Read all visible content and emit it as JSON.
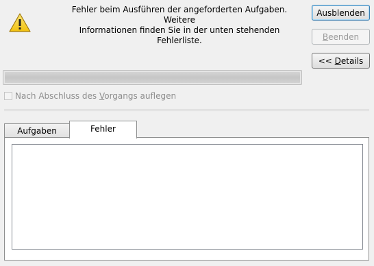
{
  "message": {
    "line1": "Fehler beim Ausführen der angeforderten Aufgaben. Weitere",
    "line2": "Informationen finden Sie in der unten stehenden Fehlerliste."
  },
  "buttons": {
    "hide": "Ausblenden",
    "finish_underlined": "B",
    "finish_rest": "eenden",
    "details_prefix": "<< ",
    "details_underlined": "D",
    "details_rest": "etails"
  },
  "progress": {
    "value": 0
  },
  "checkbox": {
    "label_pre": "Nach Abschluss des ",
    "label_underlined": "V",
    "label_post": "organgs auflegen",
    "checked": false,
    "enabled": false
  },
  "tabs": [
    {
      "label": "Aufgaben",
      "active": false
    },
    {
      "label": "Fehler",
      "active": true
    }
  ],
  "error_list": {
    "items": []
  },
  "icons": {
    "warning": "warning-icon"
  },
  "colors": {
    "warning_fill": "#f7d21f",
    "accent_border": "#3c7fb1"
  }
}
